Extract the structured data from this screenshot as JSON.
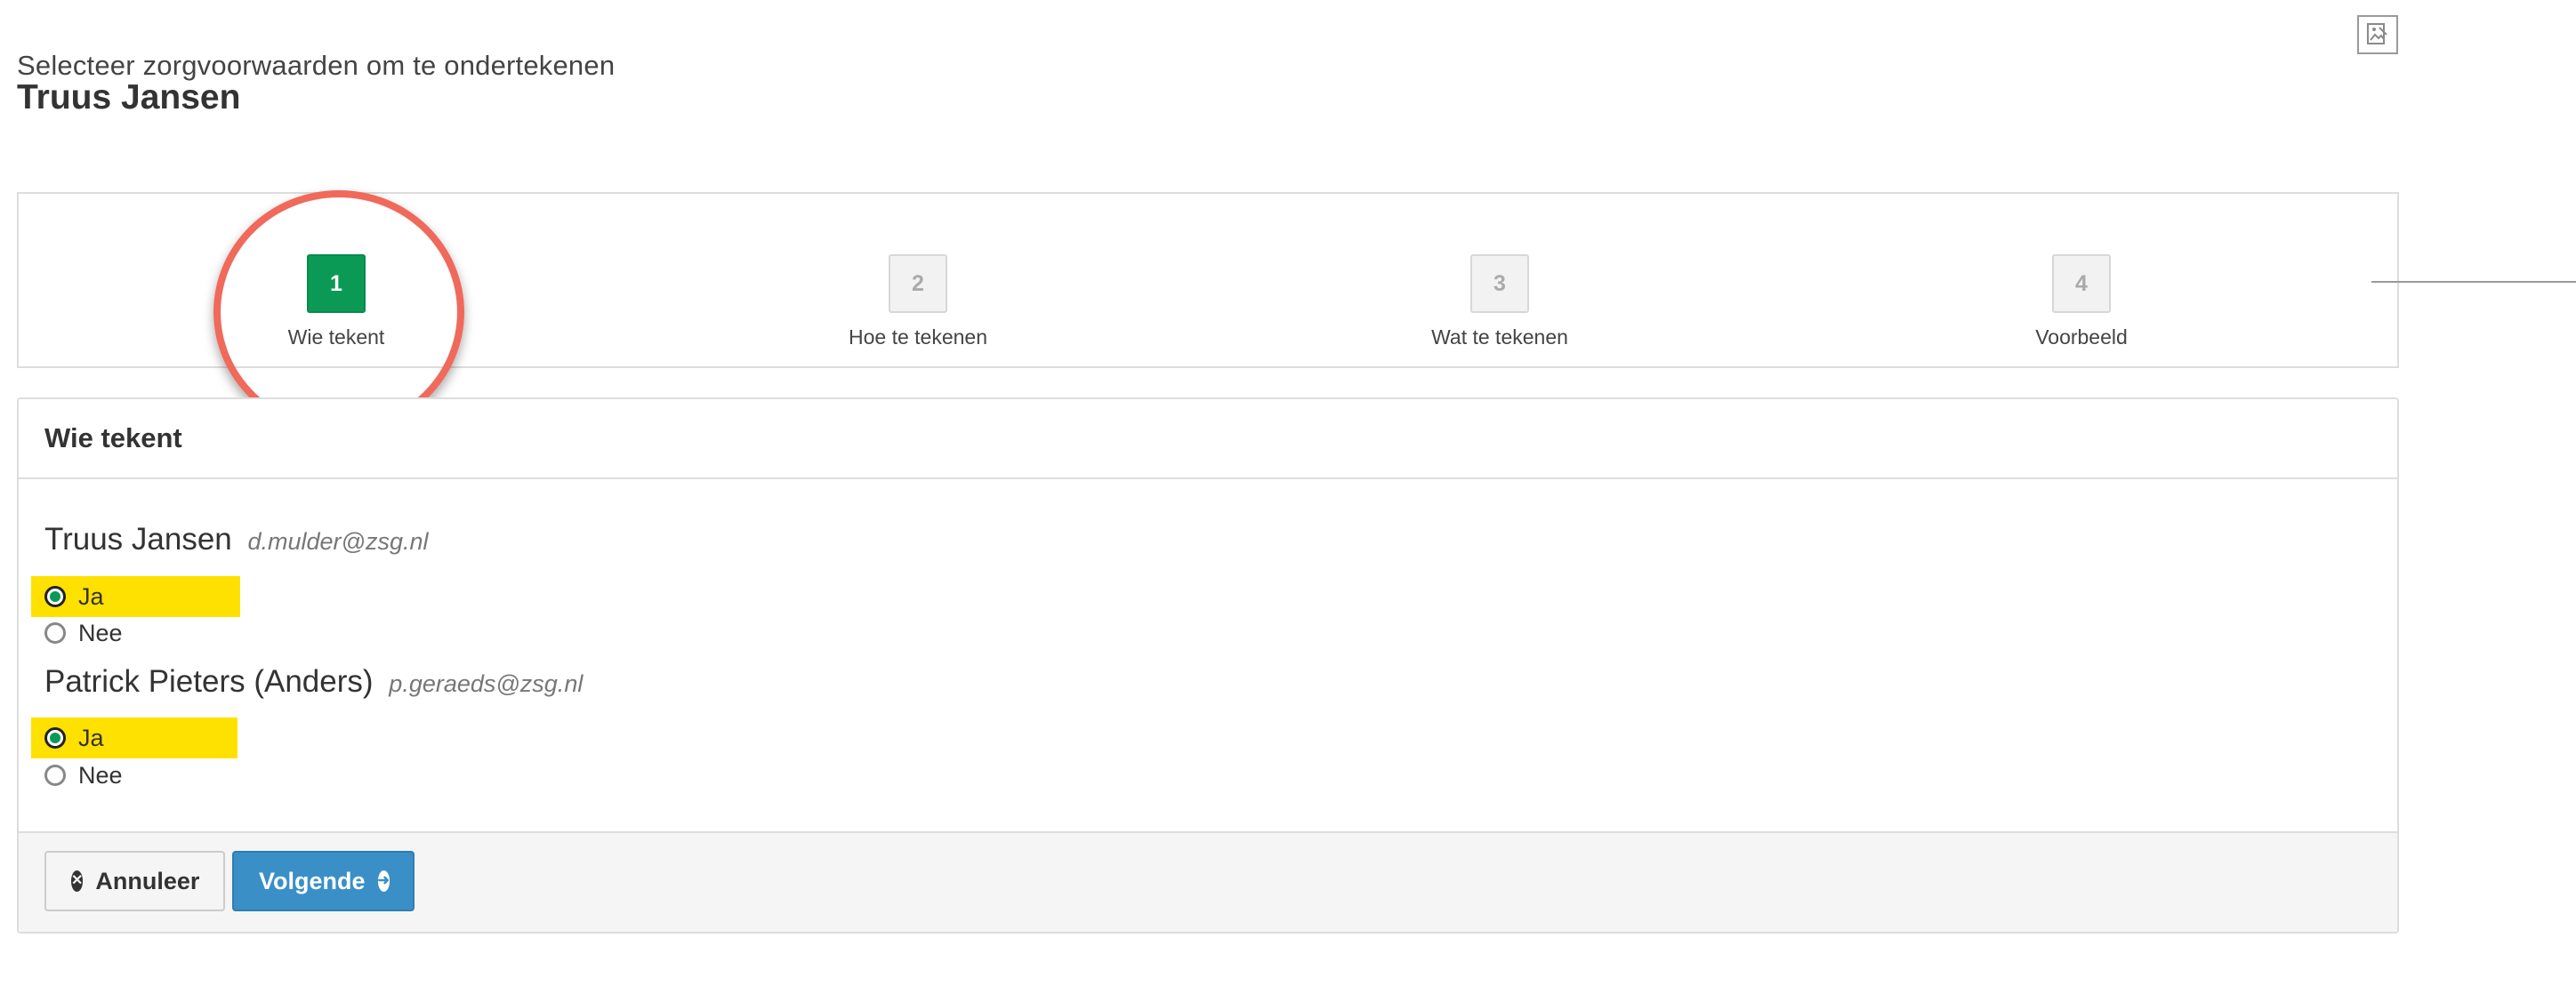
{
  "header": {
    "subtitle": "Selecteer zorgvoorwaarden om te ondertekenen",
    "title": "Truus Jansen",
    "corner_icon": "image-icon"
  },
  "steps": [
    {
      "number": "1",
      "label": "Wie tekent",
      "active": true
    },
    {
      "number": "2",
      "label": "Hoe te tekenen",
      "active": false
    },
    {
      "number": "3",
      "label": "Wat te tekenen",
      "active": false
    },
    {
      "number": "4",
      "label": "Voorbeeld",
      "active": false
    }
  ],
  "colors": {
    "active_step": "#0b9a55",
    "highlight_circle": "#f0695a",
    "option_highlight": "#ffe100",
    "primary_button": "#3a8fc7"
  },
  "panel": {
    "heading": "Wie tekent",
    "signers": [
      {
        "name": "Truus Jansen",
        "email": "d.mulder@zsg.nl",
        "options": [
          {
            "label": "Ja",
            "checked": true
          },
          {
            "label": "Nee",
            "checked": false
          }
        ]
      },
      {
        "name": "Patrick Pieters (Anders)",
        "email": "p.geraeds@zsg.nl",
        "options": [
          {
            "label": "Ja",
            "checked": true
          },
          {
            "label": "Nee",
            "checked": false
          }
        ]
      }
    ],
    "footer": {
      "cancel_label": "Annuleer",
      "cancel_icon": "close-circle-icon",
      "next_label": "Volgende",
      "next_icon": "arrow-right-circle-icon"
    }
  }
}
